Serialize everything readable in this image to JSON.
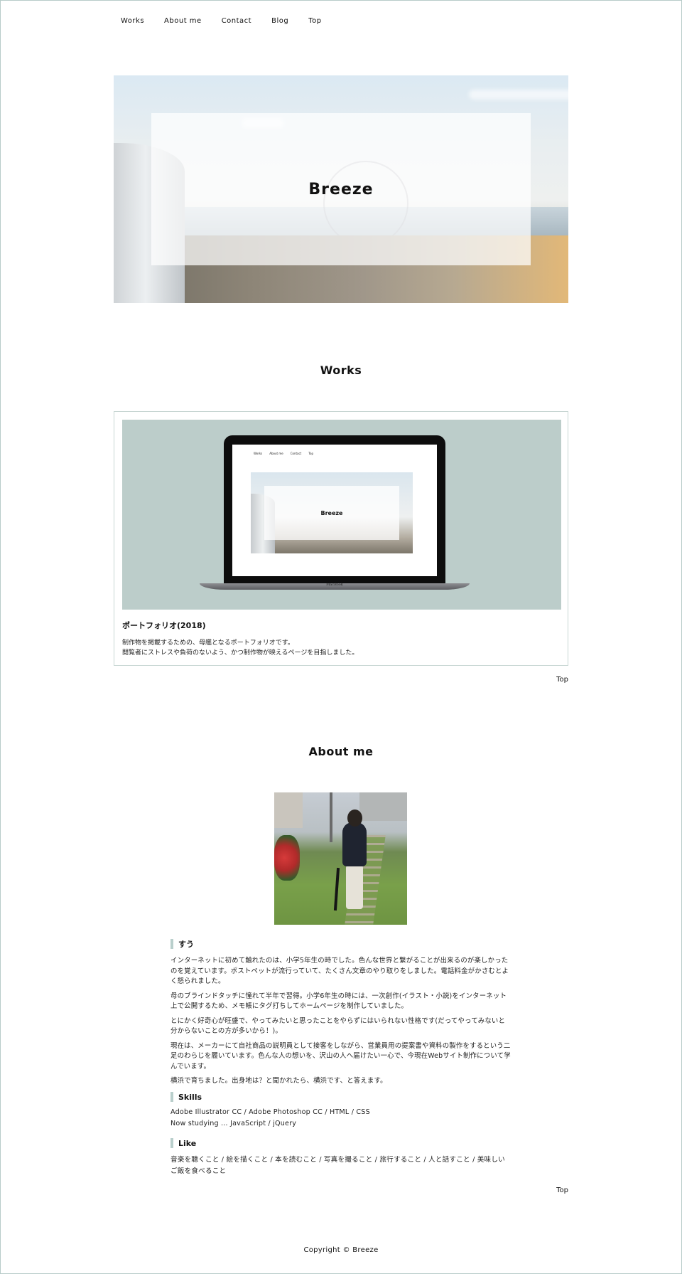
{
  "nav": {
    "items": [
      "Works",
      "About me",
      "Contact",
      "Blog",
      "Top"
    ]
  },
  "hero": {
    "title": "Breeze"
  },
  "works": {
    "heading": "Works",
    "item": {
      "mockup_nav": [
        "Works",
        "About me",
        "Contact",
        "Top"
      ],
      "mockup_title": "Breeze",
      "laptop_brand": "MacBook",
      "title": "ポートフォリオ(2018)",
      "description_lines": [
        "制作物を掲載するための、母艦となるポートフォリオです。",
        "閲覧者にストレスや負荷のないよう、かつ制作物が映えるページを目指しました。"
      ]
    },
    "top_link": "Top"
  },
  "about": {
    "heading": "About me",
    "name": "すう",
    "paragraphs": [
      "インターネットに初めて触れたのは、小学5年生の時でした。色んな世界と繋がることが出来るのが楽しかったのを覚えています。ポストペットが流行っていて、たくさん文章のやり取りをしました。電話料金がかさむとよく怒られました。",
      "母のブラインドタッチに憧れて半年で習得。小学6年生の時には、一次創作(イラスト・小説)をインターネット上で公開するため、メモ帳にタグ打ちしてホームページを制作していました。",
      "とにかく好奇心が旺盛で、やってみたいと思ったことをやらずにはいられない性格です(だってやってみないと分からないことの方が多いから！)。",
      "現在は、メーカーにて自社商品の説明員として接客をしながら、営業員用の提案書や資料の製作をするという二足のわらじを履いています。色んな人の想いを、沢山の人へ届けたい一心で、今現在Webサイト制作について学んでいます。",
      "横浜で育ちました。出身地は？と聞かれたら、横浜です、と答えます。"
    ],
    "skills_heading": "Skills",
    "skills_lines": [
      "Adobe Illustrator CC / Adobe Photoshop CC / HTML / CSS",
      "Now studying … JavaScript / jQuery"
    ],
    "like_heading": "Like",
    "like_text": "音楽を聴くこと / 絵を描くこと / 本を読むこと / 写真を撮ること / 旅行すること / 人と話すこと / 美味しいご飯を食べること",
    "top_link": "Top"
  },
  "footer": {
    "copyright": "Copyright © Breeze"
  },
  "colors": {
    "accent": "#b9cfcc",
    "border": "#b7ccc9",
    "mockup_bg": "#bccdca"
  }
}
